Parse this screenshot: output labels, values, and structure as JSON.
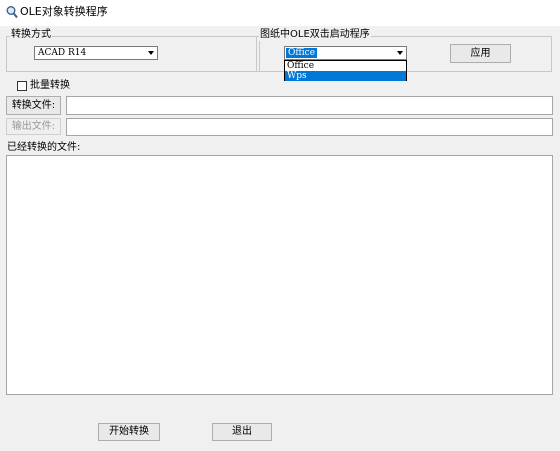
{
  "window": {
    "title": "OLE对象转换程序",
    "icon": "magnifier-icon"
  },
  "convert_mode": {
    "group_label": "转换方式",
    "selected": "ACAD R14"
  },
  "ole_launcher": {
    "group_label": "图纸中OLE双击启动程序",
    "selected": "Office",
    "options": [
      "Office",
      "Wps"
    ],
    "highlighted_option": "Wps",
    "apply_label": "应用"
  },
  "batch": {
    "label": "批量转换",
    "checked": false
  },
  "convert_file": {
    "button_label": "转换文件:",
    "value": ""
  },
  "output_file": {
    "button_label": "输出文件:",
    "value": "",
    "disabled": true
  },
  "converted_files": {
    "label": "已经转换的文件:",
    "items": []
  },
  "footer": {
    "start_label": "开始转换",
    "exit_label": "退出"
  },
  "colors": {
    "window_bg": "#f0f0f0",
    "selection": "#0078d7"
  }
}
